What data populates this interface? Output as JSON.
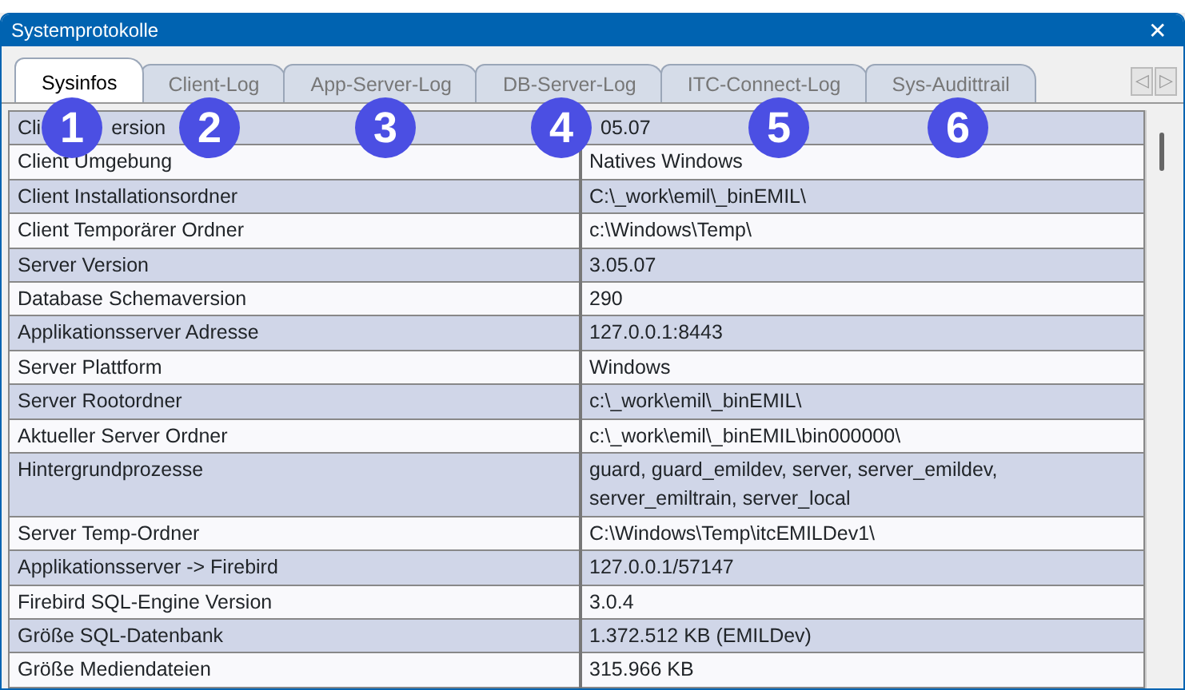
{
  "window": {
    "title": "Systemprotokolle",
    "close": "✕"
  },
  "tabs": [
    {
      "label": "Sysinfos",
      "selected": true
    },
    {
      "label": "Client-Log",
      "selected": false
    },
    {
      "label": "App-Server-Log",
      "selected": false
    },
    {
      "label": "DB-Server-Log",
      "selected": false
    },
    {
      "label": "ITC-Connect-Log",
      "selected": false
    },
    {
      "label": "Sys-Audittrail",
      "selected": false
    }
  ],
  "tab_scroll": [
    "◁",
    "▷"
  ],
  "markers": [
    "1",
    "2",
    "3",
    "4",
    "5",
    "6"
  ],
  "table": {
    "rows": [
      [
        [
          "Cli",
          "ersion"
        ],
        "05.07"
      ],
      [
        "Client Umgebung",
        "Natives Windows"
      ],
      [
        "Client Installationsordner",
        "C:\\_work\\emil\\_binEMIL\\"
      ],
      [
        "Client Temporärer Ordner",
        "c:\\Windows\\Temp\\"
      ],
      [
        "Server Version",
        "3.05.07"
      ],
      [
        "Database Schemaversion",
        "290"
      ],
      [
        "Applikationsserver Adresse",
        "127.0.0.1:8443"
      ],
      [
        "Server Plattform",
        "Windows"
      ],
      [
        "Server Rootordner",
        "c:\\_work\\emil\\_binEMIL\\"
      ],
      [
        "Aktueller Server Ordner",
        "c:\\_work\\emil\\_binEMIL\\bin000000\\"
      ],
      [
        "Hintergrundprozesse",
        "guard, guard_emildev, server, server_emildev, server_emiltrain, server_local"
      ],
      [
        "Server Temp-Ordner",
        "C:\\Windows\\Temp\\itcEMILDev1\\"
      ],
      [
        "Applikationsserver -> Firebird",
        "127.0.0.1/57147"
      ],
      [
        "Firebird SQL-Engine Version",
        "3.0.4"
      ],
      [
        "Größe SQL-Datenbank",
        "1.372.512 KB (EMILDev)"
      ],
      [
        "Größe Mediendateien",
        "315.966 KB"
      ]
    ]
  }
}
